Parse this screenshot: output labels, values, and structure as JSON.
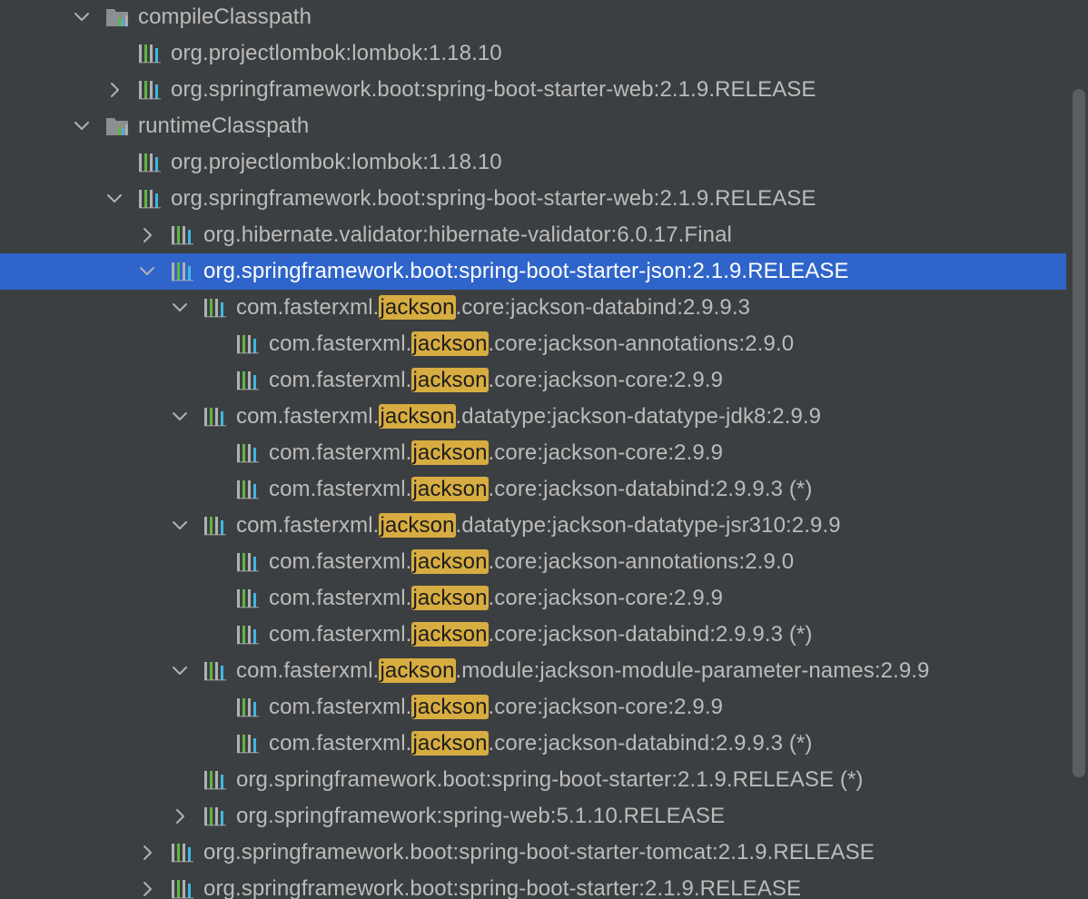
{
  "tree": {
    "rows": [
      {
        "level": 0,
        "toggle": "expanded",
        "icon": "configuration-folder-icon",
        "selected": false,
        "text": [
          "compileClasspath"
        ]
      },
      {
        "level": 1,
        "toggle": "none",
        "icon": "library-icon",
        "selected": false,
        "text": [
          "org.projectlombok:lombok:1.18.10"
        ]
      },
      {
        "level": 1,
        "toggle": "collapsed",
        "icon": "library-icon",
        "selected": false,
        "text": [
          "org.springframework.boot:spring-boot-starter-web:2.1.9.RELEASE"
        ]
      },
      {
        "level": 0,
        "toggle": "expanded",
        "icon": "configuration-folder-icon",
        "selected": false,
        "text": [
          "runtimeClasspath"
        ]
      },
      {
        "level": 1,
        "toggle": "none",
        "icon": "library-icon",
        "selected": false,
        "text": [
          "org.projectlombok:lombok:1.18.10"
        ]
      },
      {
        "level": 1,
        "toggle": "expanded",
        "icon": "library-icon",
        "selected": false,
        "text": [
          "org.springframework.boot:spring-boot-starter-web:2.1.9.RELEASE"
        ]
      },
      {
        "level": 2,
        "toggle": "collapsed",
        "icon": "library-icon",
        "selected": false,
        "text": [
          "org.hibernate.validator:hibernate-validator:6.0.17.Final"
        ]
      },
      {
        "level": 2,
        "toggle": "expanded",
        "icon": "library-icon",
        "selected": true,
        "text": [
          "org.springframework.boot:spring-boot-starter-json:2.1.9.RELEASE"
        ]
      },
      {
        "level": 3,
        "toggle": "expanded",
        "icon": "library-icon",
        "selected": false,
        "text": [
          "com.fasterxml.",
          "jackson",
          ".core:jackson-databind:2.9.9.3"
        ]
      },
      {
        "level": 4,
        "toggle": "none",
        "icon": "library-icon",
        "selected": false,
        "text": [
          "com.fasterxml.",
          "jackson",
          ".core:jackson-annotations:2.9.0"
        ]
      },
      {
        "level": 4,
        "toggle": "none",
        "icon": "library-icon",
        "selected": false,
        "text": [
          "com.fasterxml.",
          "jackson",
          ".core:jackson-core:2.9.9"
        ]
      },
      {
        "level": 3,
        "toggle": "expanded",
        "icon": "library-icon",
        "selected": false,
        "text": [
          "com.fasterxml.",
          "jackson",
          ".datatype:jackson-datatype-jdk8:2.9.9"
        ]
      },
      {
        "level": 4,
        "toggle": "none",
        "icon": "library-icon",
        "selected": false,
        "text": [
          "com.fasterxml.",
          "jackson",
          ".core:jackson-core:2.9.9"
        ]
      },
      {
        "level": 4,
        "toggle": "none",
        "icon": "library-icon",
        "selected": false,
        "text": [
          "com.fasterxml.",
          "jackson",
          ".core:jackson-databind:2.9.9.3 (*)"
        ]
      },
      {
        "level": 3,
        "toggle": "expanded",
        "icon": "library-icon",
        "selected": false,
        "text": [
          "com.fasterxml.",
          "jackson",
          ".datatype:jackson-datatype-jsr310:2.9.9"
        ]
      },
      {
        "level": 4,
        "toggle": "none",
        "icon": "library-icon",
        "selected": false,
        "text": [
          "com.fasterxml.",
          "jackson",
          ".core:jackson-annotations:2.9.0"
        ]
      },
      {
        "level": 4,
        "toggle": "none",
        "icon": "library-icon",
        "selected": false,
        "text": [
          "com.fasterxml.",
          "jackson",
          ".core:jackson-core:2.9.9"
        ]
      },
      {
        "level": 4,
        "toggle": "none",
        "icon": "library-icon",
        "selected": false,
        "text": [
          "com.fasterxml.",
          "jackson",
          ".core:jackson-databind:2.9.9.3 (*)"
        ]
      },
      {
        "level": 3,
        "toggle": "expanded",
        "icon": "library-icon",
        "selected": false,
        "text": [
          "com.fasterxml.",
          "jackson",
          ".module:jackson-module-parameter-names:2.9.9"
        ]
      },
      {
        "level": 4,
        "toggle": "none",
        "icon": "library-icon",
        "selected": false,
        "text": [
          "com.fasterxml.",
          "jackson",
          ".core:jackson-core:2.9.9"
        ]
      },
      {
        "level": 4,
        "toggle": "none",
        "icon": "library-icon",
        "selected": false,
        "text": [
          "com.fasterxml.",
          "jackson",
          ".core:jackson-databind:2.9.9.3 (*)"
        ]
      },
      {
        "level": 3,
        "toggle": "none",
        "icon": "library-icon",
        "selected": false,
        "text": [
          "org.springframework.boot:spring-boot-starter:2.1.9.RELEASE (*)"
        ]
      },
      {
        "level": 3,
        "toggle": "collapsed",
        "icon": "library-icon",
        "selected": false,
        "text": [
          "org.springframework:spring-web:5.1.10.RELEASE"
        ]
      },
      {
        "level": 2,
        "toggle": "collapsed",
        "icon": "library-icon",
        "selected": false,
        "text": [
          "org.springframework.boot:spring-boot-starter-tomcat:2.1.9.RELEASE"
        ]
      },
      {
        "level": 2,
        "toggle": "collapsed",
        "icon": "library-icon",
        "selected": false,
        "text": [
          "org.springframework.boot:spring-boot-starter:2.1.9.RELEASE"
        ]
      }
    ],
    "search_highlight": "jackson",
    "colors": {
      "background": "#3c3f41",
      "text": "#bbbbbb",
      "selection": "#2f65ca",
      "selected_text": "#ffffff",
      "highlight": "#d7ac41",
      "highlight_text": "#1e1e1e",
      "lib_green": "#62b543",
      "lib_blue": "#40b6e0",
      "lib_gray": "#afb1b3",
      "chevron": "#afb1b3"
    }
  }
}
